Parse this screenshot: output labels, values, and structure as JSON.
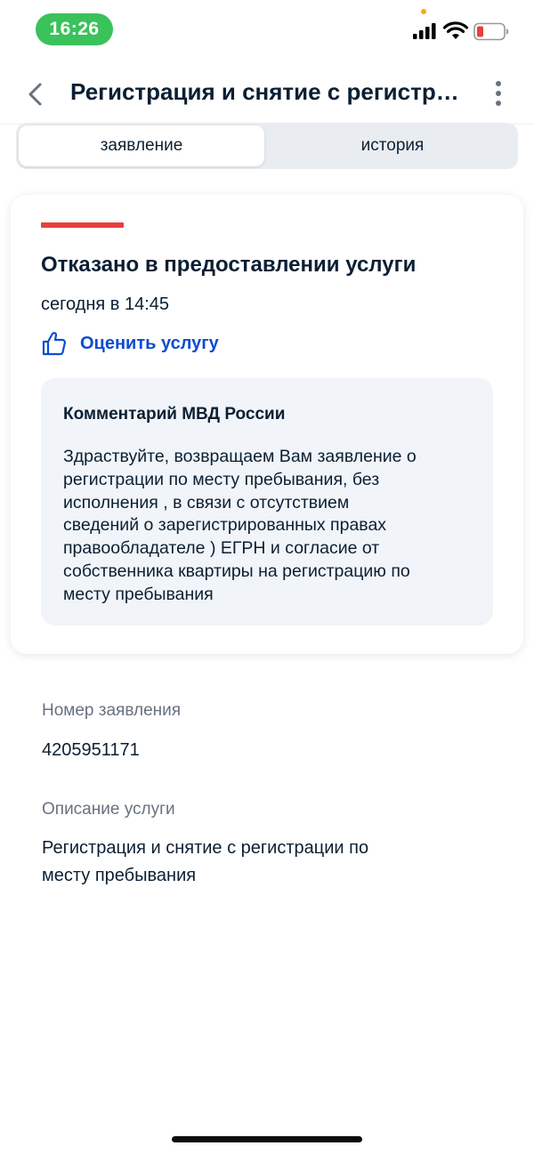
{
  "status_bar": {
    "time": "16:26"
  },
  "header": {
    "title": "Регистрация и снятие с регистрации по месту пребывания"
  },
  "tabs": [
    {
      "label": "заявление",
      "active": true
    },
    {
      "label": "история",
      "active": false
    }
  ],
  "status_card": {
    "status_title": "Отказано в предоставлении услуги",
    "status_color": "#e8403d",
    "date": "сегодня в 14:45",
    "rate_label": "Оценить услугу",
    "comment": {
      "title": "Комментарий МВД России",
      "lines": [
        "Здраствуйте, возвращаем Вам заявление о",
        "регистрации по месту пребывания, без",
        "исполнения , в связи с отсутствием",
        "сведений о зарегистрированных правах",
        "правообладателе ) ЕГРН и согласие от",
        "собственника квартиры на регистрацию по",
        "месту пребывания"
      ]
    }
  },
  "details": {
    "number_label": "Номер заявления",
    "number_value": "4205951171",
    "description_label": "Описание услуги",
    "description_lines": [
      "Регистрация и снятие с регистрации по",
      "месту пребывания"
    ]
  },
  "colors": {
    "accent": "#0d4cd3",
    "time_pill": "#3ac25b"
  }
}
